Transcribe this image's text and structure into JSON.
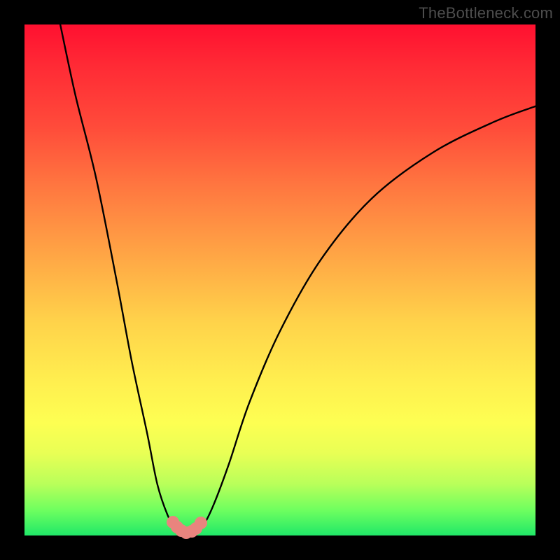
{
  "watermark": "TheBottleneck.com",
  "chart_data": {
    "type": "line",
    "title": "",
    "xlabel": "",
    "ylabel": "",
    "xlim": [
      0,
      100
    ],
    "ylim": [
      0,
      100
    ],
    "grid": false,
    "legend": false,
    "series": [
      {
        "name": "left-branch",
        "x": [
          7,
          10,
          14,
          18,
          21,
          24,
          26,
          28,
          29.5,
          30.5
        ],
        "y": [
          100,
          86,
          70,
          50,
          34,
          20,
          10,
          4,
          1.5,
          0.8
        ]
      },
      {
        "name": "right-branch",
        "x": [
          33.5,
          35,
          37,
          40,
          44,
          50,
          58,
          68,
          80,
          92,
          100
        ],
        "y": [
          0.8,
          2,
          6,
          14,
          26,
          40,
          54,
          66,
          75,
          81,
          84
        ]
      }
    ],
    "markers": {
      "name": "bottom-cluster",
      "color": "#e9847e",
      "points": [
        {
          "x": 29.0,
          "y": 2.6
        },
        {
          "x": 29.8,
          "y": 1.6
        },
        {
          "x": 30.7,
          "y": 0.9
        },
        {
          "x": 31.7,
          "y": 0.6
        },
        {
          "x": 32.7,
          "y": 0.8
        },
        {
          "x": 33.6,
          "y": 1.4
        },
        {
          "x": 34.5,
          "y": 2.4
        }
      ]
    },
    "background": {
      "gradient": "vertical",
      "stops": [
        {
          "pos": 0.0,
          "color": "#ff1030"
        },
        {
          "pos": 0.45,
          "color": "#ffa545"
        },
        {
          "pos": 0.78,
          "color": "#fdff52"
        },
        {
          "pos": 1.0,
          "color": "#20e868"
        }
      ]
    }
  }
}
